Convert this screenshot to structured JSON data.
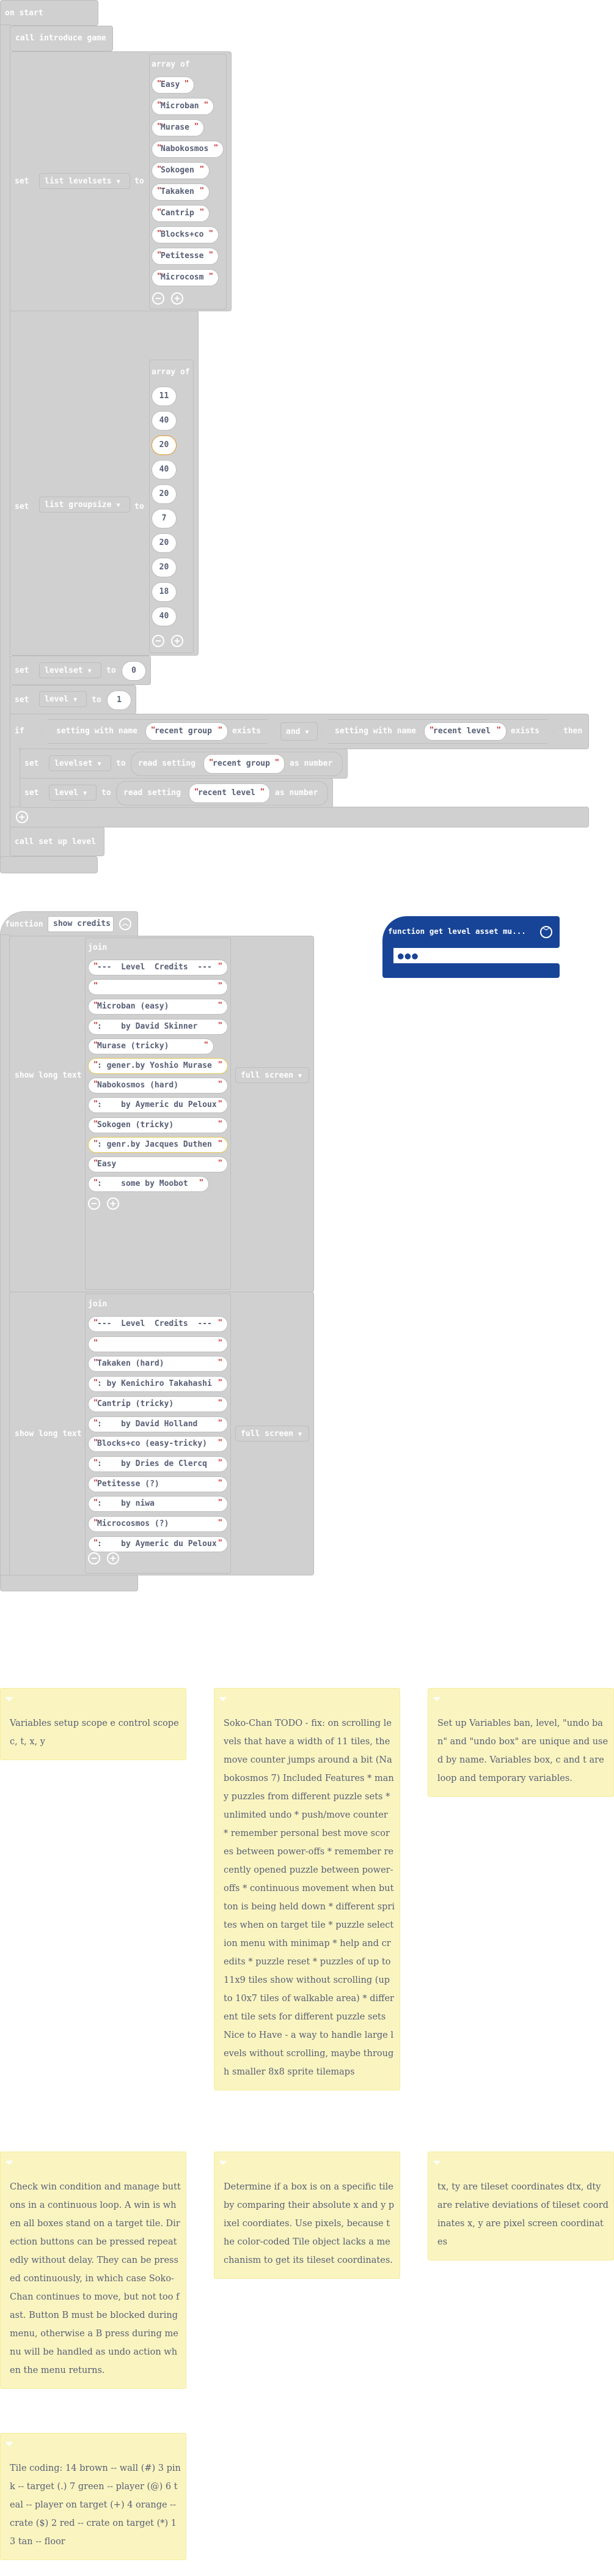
{
  "on_start": {
    "label": "on start",
    "call_introduce": "call introduce game",
    "set_levelsets": {
      "set": "set",
      "variable": "list levelsets",
      "to": "to",
      "array_label": "array of",
      "items": [
        "Easy",
        "Microban",
        "Murase",
        "Nabokosmos",
        "Sokogen",
        "Takaken",
        "Cantrip",
        "Blocks+co",
        "Petitesse",
        "Microcosm"
      ]
    },
    "set_groupsize": {
      "set": "set",
      "variable": "list groupsize",
      "to": "to",
      "array_label": "array of",
      "items": [
        "11",
        "40",
        "20",
        "40",
        "20",
        "7",
        "20",
        "20",
        "18",
        "40"
      ],
      "highlighted_index": 2
    },
    "set_levelset": {
      "set": "set",
      "variable": "levelset",
      "to": "to",
      "value": "0"
    },
    "set_level": {
      "set": "set",
      "variable": "level",
      "to": "to",
      "value": "1"
    },
    "if_block": {
      "if": "if",
      "then": "then",
      "cond1": {
        "prefix": "setting with name",
        "name": "recent group",
        "suffix": "exists"
      },
      "op": "and",
      "cond2": {
        "prefix": "setting with name",
        "name": "recent level",
        "suffix": "exists"
      },
      "body1": {
        "set": "set",
        "variable": "levelset",
        "to": "to",
        "read": "read setting",
        "name": "recent group",
        "as": "as number"
      },
      "body2": {
        "set": "set",
        "variable": "level",
        "to": "to",
        "read": "read setting",
        "name": "recent level",
        "as": "as number"
      }
    },
    "call_setup": "call set up level"
  },
  "show_credits": {
    "function_label": "function",
    "name": "show credits",
    "show_long_text": "show long text",
    "join_label": "join",
    "mode": "full screen",
    "join1": [
      "---  Level  Credits  --- ",
      "",
      "Microban (easy)",
      ":    by David Skinner",
      "Murase (tricky)",
      ": gener.by Yoshio Murase",
      "Nabokosmos (hard)",
      ":    by Aymeric du Peloux",
      "Sokogen (tricky)",
      ": genr.by Jacques Duthen",
      "Easy",
      ":    some by Moobot"
    ],
    "join1_highlighted": [
      5,
      9
    ],
    "join2": [
      "---  Level  Credits  --- ",
      "",
      "Takaken (hard)",
      ": by Kenichiro Takahashi",
      "Cantrip (tricky)",
      ":    by David Holland",
      "Blocks+co (easy-tricky)",
      ":    by Dries de Clercq",
      "Petitesse (?)",
      ":    by niwa",
      "Microcosmos (?)",
      ":    by Aymeric du Peloux"
    ]
  },
  "get_level_asset": {
    "label": "function get level asset mu...",
    "color": "#174497"
  },
  "comments": [
    "Variables setup scope e control scope c, t, x, y",
    "Soko-Chan TODO - fix: on scrolling levels that have a width of 11 tiles, the move counter jumps around a bit (Nabokosmos 7) Included Features * many puzzles from different puzzle sets * unlimited undo * push/move counter * remember personal best move scores between power-offs * remember recently opened puzzle between power-offs * continuous movement when button is being held down * different sprites when on target tile * puzzle selection menu with minimap * help and credits * puzzle reset * puzzles of up to 11x9 tiles show without scrolling (up to 10x7 tiles of walkable area) * different tile sets for different puzzle sets Nice to Have - a way to handle large levels without scrolling, maybe through smaller 8x8 sprite tilemaps",
    "Set up Variables ban, level, \"undo ban\" and \"undo box\" are unique and used by name. Variables box, c and t are loop and temporary variables.",
    "Check win condition and manage buttons in a continuous loop. A win is when all boxes stand on a target tile. Direction buttons can be pressed repeatedly without delay. They can be pressed continuously, in which case Soko-Chan continues to move, but not too fast. Button B must be blocked during menu, otherwise a B press during menu will be handled as undo action when the menu returns.",
    "Determine if a box is on a specific tile by comparing their absolute x and y pixel coordiates. Use pixels, because the color-coded Tile object lacks a mechanism to get its tileset coordinates.",
    "tx, ty are tileset coordinates dtx, dty are relative deviations of tileset coordinates x, y are pixel screen coordinates",
    "Tile coding: 14 brown -- wall (#) 3 pink -- target (.) 7 green -- player (@) 6 teal -- player on target (+) 4 orange -- crate ($) 2 red -- crate on target (*) 13 tan -- floor"
  ]
}
